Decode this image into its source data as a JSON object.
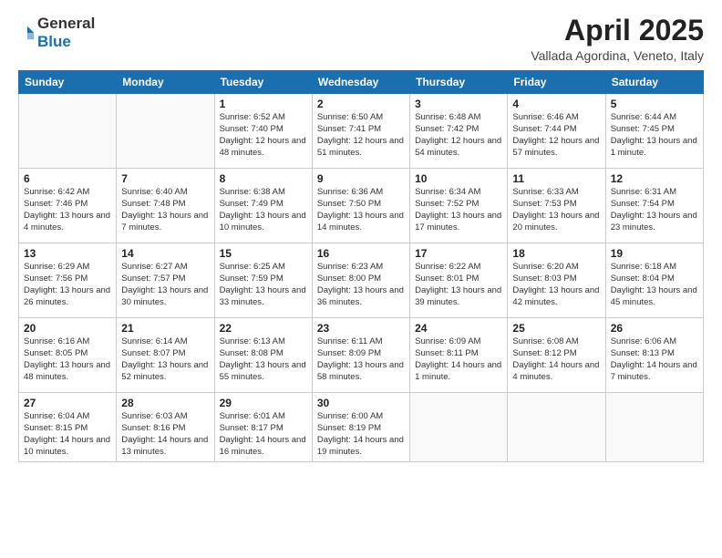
{
  "logo": {
    "general": "General",
    "blue": "Blue"
  },
  "header": {
    "month": "April 2025",
    "location": "Vallada Agordina, Veneto, Italy"
  },
  "weekdays": [
    "Sunday",
    "Monday",
    "Tuesday",
    "Wednesday",
    "Thursday",
    "Friday",
    "Saturday"
  ],
  "weeks": [
    [
      {
        "day": "",
        "info": ""
      },
      {
        "day": "",
        "info": ""
      },
      {
        "day": "1",
        "info": "Sunrise: 6:52 AM\nSunset: 7:40 PM\nDaylight: 12 hours and 48 minutes."
      },
      {
        "day": "2",
        "info": "Sunrise: 6:50 AM\nSunset: 7:41 PM\nDaylight: 12 hours and 51 minutes."
      },
      {
        "day": "3",
        "info": "Sunrise: 6:48 AM\nSunset: 7:42 PM\nDaylight: 12 hours and 54 minutes."
      },
      {
        "day": "4",
        "info": "Sunrise: 6:46 AM\nSunset: 7:44 PM\nDaylight: 12 hours and 57 minutes."
      },
      {
        "day": "5",
        "info": "Sunrise: 6:44 AM\nSunset: 7:45 PM\nDaylight: 13 hours and 1 minute."
      }
    ],
    [
      {
        "day": "6",
        "info": "Sunrise: 6:42 AM\nSunset: 7:46 PM\nDaylight: 13 hours and 4 minutes."
      },
      {
        "day": "7",
        "info": "Sunrise: 6:40 AM\nSunset: 7:48 PM\nDaylight: 13 hours and 7 minutes."
      },
      {
        "day": "8",
        "info": "Sunrise: 6:38 AM\nSunset: 7:49 PM\nDaylight: 13 hours and 10 minutes."
      },
      {
        "day": "9",
        "info": "Sunrise: 6:36 AM\nSunset: 7:50 PM\nDaylight: 13 hours and 14 minutes."
      },
      {
        "day": "10",
        "info": "Sunrise: 6:34 AM\nSunset: 7:52 PM\nDaylight: 13 hours and 17 minutes."
      },
      {
        "day": "11",
        "info": "Sunrise: 6:33 AM\nSunset: 7:53 PM\nDaylight: 13 hours and 20 minutes."
      },
      {
        "day": "12",
        "info": "Sunrise: 6:31 AM\nSunset: 7:54 PM\nDaylight: 13 hours and 23 minutes."
      }
    ],
    [
      {
        "day": "13",
        "info": "Sunrise: 6:29 AM\nSunset: 7:56 PM\nDaylight: 13 hours and 26 minutes."
      },
      {
        "day": "14",
        "info": "Sunrise: 6:27 AM\nSunset: 7:57 PM\nDaylight: 13 hours and 30 minutes."
      },
      {
        "day": "15",
        "info": "Sunrise: 6:25 AM\nSunset: 7:59 PM\nDaylight: 13 hours and 33 minutes."
      },
      {
        "day": "16",
        "info": "Sunrise: 6:23 AM\nSunset: 8:00 PM\nDaylight: 13 hours and 36 minutes."
      },
      {
        "day": "17",
        "info": "Sunrise: 6:22 AM\nSunset: 8:01 PM\nDaylight: 13 hours and 39 minutes."
      },
      {
        "day": "18",
        "info": "Sunrise: 6:20 AM\nSunset: 8:03 PM\nDaylight: 13 hours and 42 minutes."
      },
      {
        "day": "19",
        "info": "Sunrise: 6:18 AM\nSunset: 8:04 PM\nDaylight: 13 hours and 45 minutes."
      }
    ],
    [
      {
        "day": "20",
        "info": "Sunrise: 6:16 AM\nSunset: 8:05 PM\nDaylight: 13 hours and 48 minutes."
      },
      {
        "day": "21",
        "info": "Sunrise: 6:14 AM\nSunset: 8:07 PM\nDaylight: 13 hours and 52 minutes."
      },
      {
        "day": "22",
        "info": "Sunrise: 6:13 AM\nSunset: 8:08 PM\nDaylight: 13 hours and 55 minutes."
      },
      {
        "day": "23",
        "info": "Sunrise: 6:11 AM\nSunset: 8:09 PM\nDaylight: 13 hours and 58 minutes."
      },
      {
        "day": "24",
        "info": "Sunrise: 6:09 AM\nSunset: 8:11 PM\nDaylight: 14 hours and 1 minute."
      },
      {
        "day": "25",
        "info": "Sunrise: 6:08 AM\nSunset: 8:12 PM\nDaylight: 14 hours and 4 minutes."
      },
      {
        "day": "26",
        "info": "Sunrise: 6:06 AM\nSunset: 8:13 PM\nDaylight: 14 hours and 7 minutes."
      }
    ],
    [
      {
        "day": "27",
        "info": "Sunrise: 6:04 AM\nSunset: 8:15 PM\nDaylight: 14 hours and 10 minutes."
      },
      {
        "day": "28",
        "info": "Sunrise: 6:03 AM\nSunset: 8:16 PM\nDaylight: 14 hours and 13 minutes."
      },
      {
        "day": "29",
        "info": "Sunrise: 6:01 AM\nSunset: 8:17 PM\nDaylight: 14 hours and 16 minutes."
      },
      {
        "day": "30",
        "info": "Sunrise: 6:00 AM\nSunset: 8:19 PM\nDaylight: 14 hours and 19 minutes."
      },
      {
        "day": "",
        "info": ""
      },
      {
        "day": "",
        "info": ""
      },
      {
        "day": "",
        "info": ""
      }
    ]
  ]
}
